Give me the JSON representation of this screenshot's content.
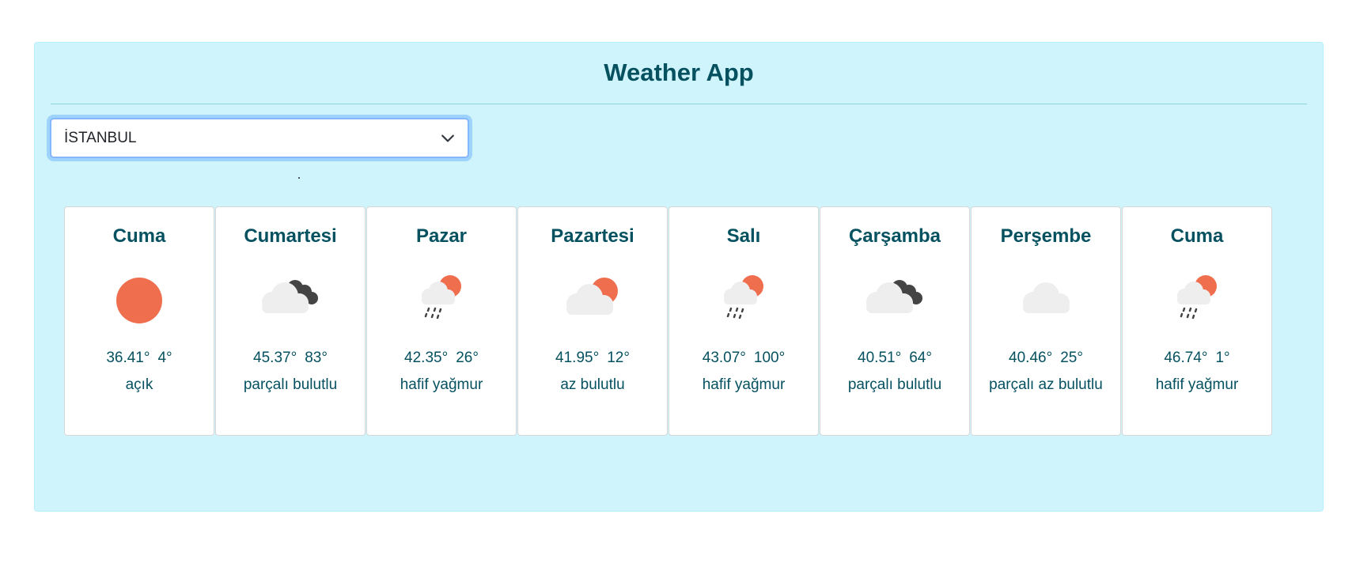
{
  "app": {
    "title": "Weather App"
  },
  "city_select": {
    "selected": "İSTANBUL"
  },
  "colors": {
    "panel_bg": "#cff4fc",
    "heading": "#055160",
    "sun": "#ef6e4e",
    "cloud": "#eeeeee",
    "dark_cloud": "#444444"
  },
  "forecast": [
    {
      "day": "Cuma",
      "icon": "clear-sun-icon",
      "temp_main": "36.41°",
      "temp_secondary": "4°",
      "description": "açık"
    },
    {
      "day": "Cumartesi",
      "icon": "broken-clouds-icon",
      "temp_main": "45.37°",
      "temp_secondary": "83°",
      "description": "parçalı bulutlu"
    },
    {
      "day": "Pazar",
      "icon": "light-rain-icon",
      "temp_main": "42.35°",
      "temp_secondary": "26°",
      "description": "hafif yağmur"
    },
    {
      "day": "Pazartesi",
      "icon": "few-clouds-icon",
      "temp_main": "41.95°",
      "temp_secondary": "12°",
      "description": "az bulutlu"
    },
    {
      "day": "Salı",
      "icon": "light-rain-icon",
      "temp_main": "43.07°",
      "temp_secondary": "100°",
      "description": "hafif yağmur"
    },
    {
      "day": "Çarşamba",
      "icon": "broken-clouds-icon",
      "temp_main": "40.51°",
      "temp_secondary": "64°",
      "description": "parçalı bulutlu"
    },
    {
      "day": "Perşembe",
      "icon": "scattered-clouds-icon",
      "temp_main": "40.46°",
      "temp_secondary": "25°",
      "description": "parçalı az bulutlu"
    },
    {
      "day": "Cuma",
      "icon": "light-rain-icon",
      "temp_main": "46.74°",
      "temp_secondary": "1°",
      "description": "hafif yağmur"
    }
  ]
}
